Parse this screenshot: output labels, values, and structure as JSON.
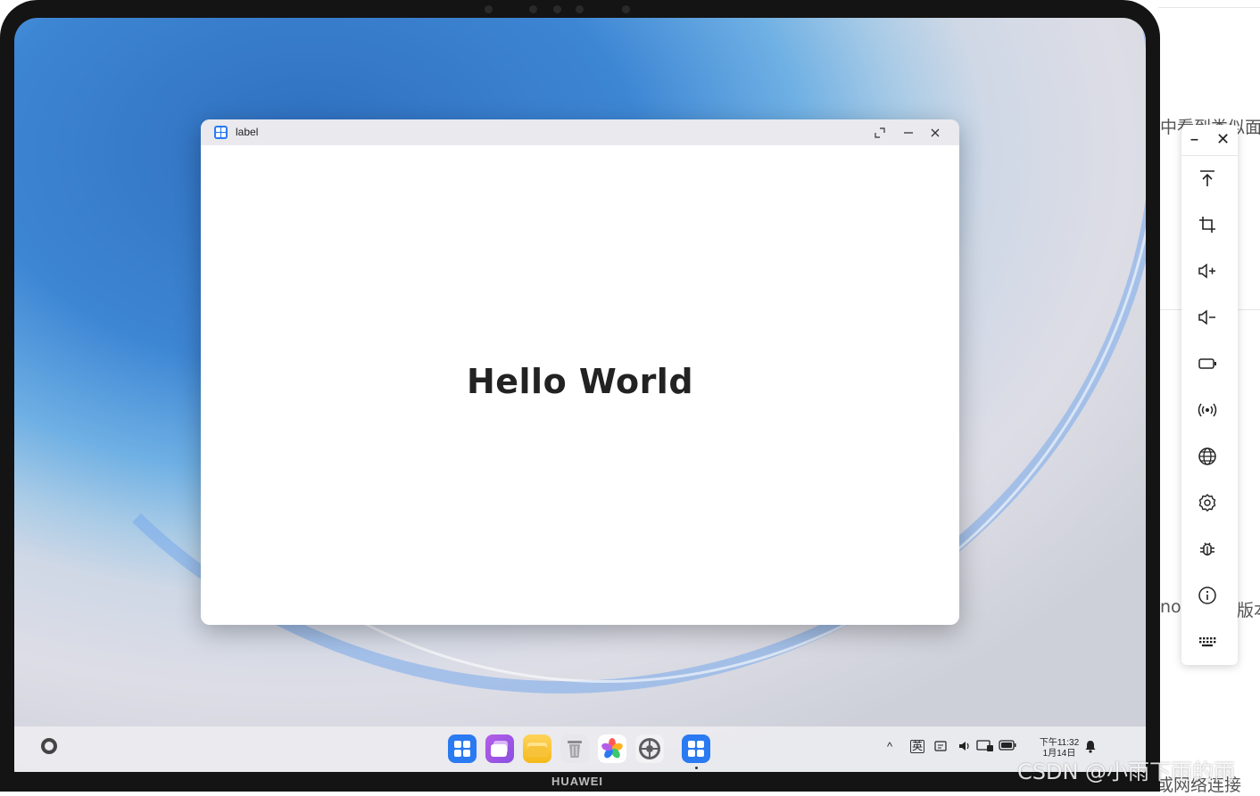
{
  "background_page": {
    "text_top": "中看到类似面",
    "text_mid_left": "nor",
    "text_mid_right": "版本",
    "text_bottom": "或网络连接"
  },
  "device": {
    "brand": "HUAWEI"
  },
  "window": {
    "title": "label",
    "content_text": "Hello World",
    "buttons": {
      "restore": "restore",
      "minimize": "minimize",
      "close": "close"
    }
  },
  "taskbar": {
    "dock_apps": [
      "app-center",
      "multi-window",
      "files",
      "recycle-bin",
      "gallery",
      "settings",
      "running-app"
    ],
    "tray": {
      "chevron": "^",
      "ime": "英",
      "clock_time": "下午11:32",
      "clock_date": "1月14日"
    }
  },
  "sidebar": {
    "minimize_label": "–",
    "close_label": "✕",
    "tools": [
      "go-to-top",
      "screenshot-crop",
      "volume-up",
      "volume-down",
      "battery",
      "wireless",
      "globe",
      "settings",
      "debug-bug",
      "info",
      "keyboard"
    ]
  },
  "watermark": "CSDN @小雨下雨的雨",
  "colors": {
    "accent": "#2a7af2",
    "window_title_bg": "#e9e9ee",
    "device_frame": "#141414"
  }
}
